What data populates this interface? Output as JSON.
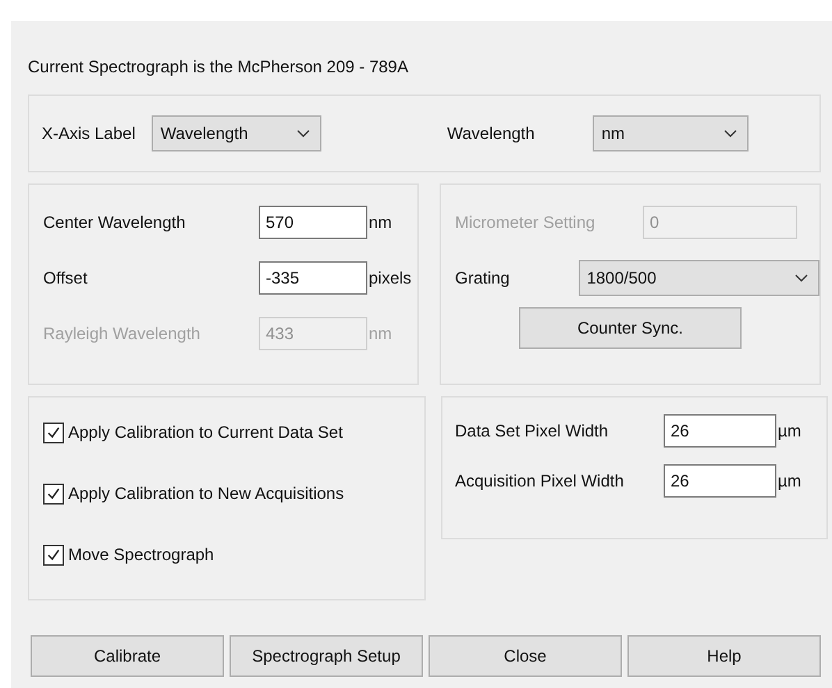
{
  "heading": "Current Spectrograph is the McPherson 209 - 789A",
  "axis": {
    "label": "X-Axis Label",
    "value": "Wavelength",
    "unit_label": "Wavelength",
    "unit_value": "nm"
  },
  "position_fields": [
    {
      "label": "Center Wavelength",
      "value": "570",
      "unit": "nm",
      "disabled": false
    },
    {
      "label": "Offset",
      "value": "-335",
      "unit": "pixels",
      "disabled": false
    },
    {
      "label": "Rayleigh Wavelength",
      "value": "433",
      "unit": "nm",
      "disabled": true
    }
  ],
  "micrometer": {
    "label": "Micrometer Setting",
    "value": "0",
    "disabled": true
  },
  "grating": {
    "label": "Grating",
    "value": "1800/500"
  },
  "sync_button": "Counter Sync.",
  "options": [
    {
      "label": "Apply Calibration to Current Data Set",
      "checked": true
    },
    {
      "label": "Apply Calibration to New Acquisitions",
      "checked": true
    },
    {
      "label": "Move Spectrograph",
      "checked": true
    }
  ],
  "pixel_widths": [
    {
      "label": "Data Set Pixel Width",
      "value": "26",
      "unit": "µm"
    },
    {
      "label": "Acquisition Pixel Width",
      "value": "26",
      "unit": "µm"
    }
  ],
  "buttons": [
    "Calibrate",
    "Spectrograph Setup",
    "Close",
    "Help"
  ]
}
